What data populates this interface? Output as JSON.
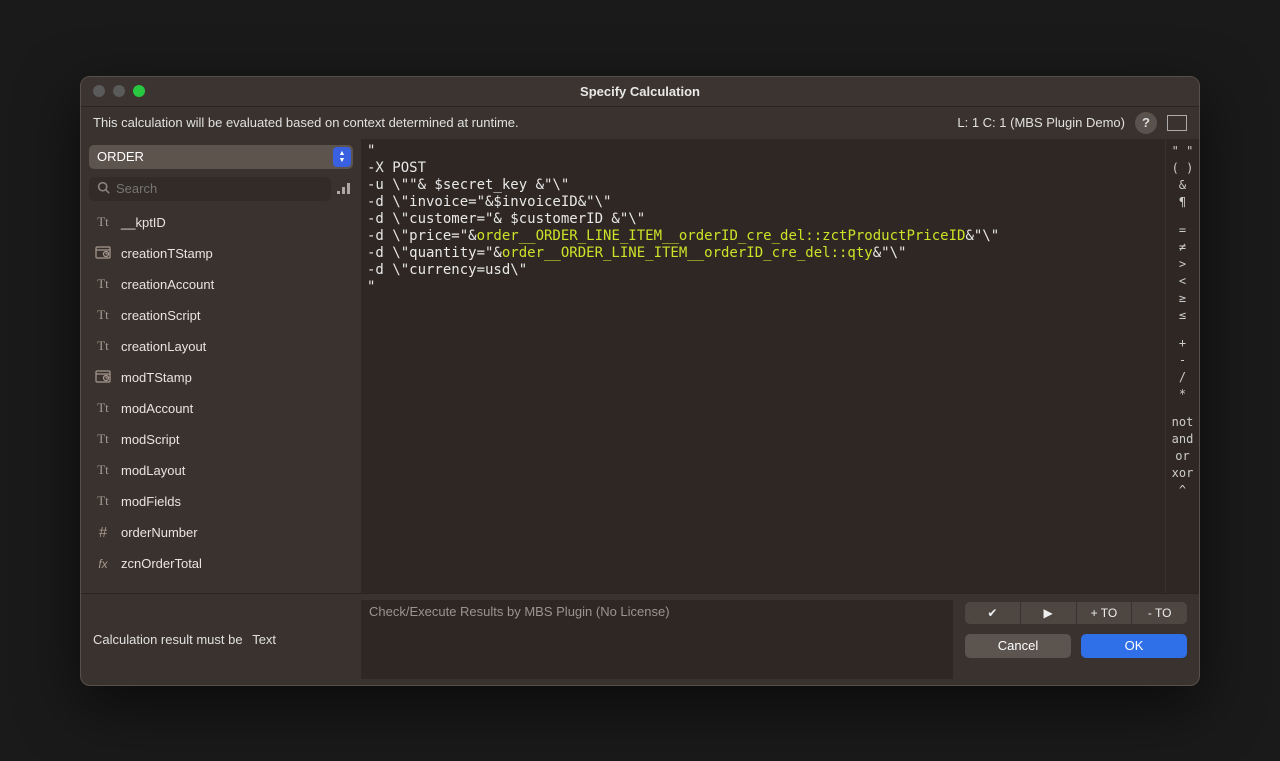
{
  "window": {
    "title": "Specify Calculation"
  },
  "infobar": {
    "context_text": "This calculation will be evaluated based on context determined at runtime.",
    "cursor_info": "L: 1 C: 1 (MBS Plugin Demo)"
  },
  "sidebar": {
    "table_name": "ORDER",
    "search_placeholder": "Search",
    "fields": [
      {
        "icon": "Tt",
        "label": "__kptID"
      },
      {
        "icon": "ts",
        "label": "creationTStamp"
      },
      {
        "icon": "Tt",
        "label": "creationAccount"
      },
      {
        "icon": "Tt",
        "label": "creationScript"
      },
      {
        "icon": "Tt",
        "label": "creationLayout"
      },
      {
        "icon": "ts",
        "label": "modTStamp"
      },
      {
        "icon": "Tt",
        "label": "modAccount"
      },
      {
        "icon": "Tt",
        "label": "modScript"
      },
      {
        "icon": "Tt",
        "label": "modLayout"
      },
      {
        "icon": "Tt",
        "label": "modFields"
      },
      {
        "icon": "#",
        "label": "orderNumber"
      },
      {
        "icon": "fx",
        "label": "zcnOrderTotal"
      }
    ]
  },
  "editor": {
    "lines": [
      {
        "t": "\""
      },
      {
        "t": "-X POST"
      },
      {
        "t": "-u \\\"\"& $secret_key &\"\\\""
      },
      {
        "t": "-d \\\"invoice=\"&$invoiceID&\"\\\""
      },
      {
        "t": "-d \\\"customer=\"& $customerID &\"\\\""
      },
      {
        "pre": "-d \\\"price=\"&",
        "hl": "order__ORDER_LINE_ITEM__orderID_cre_del::zctProductPriceID",
        "post": "&\"\\\""
      },
      {
        "pre": "-d \\\"quantity=\"&",
        "hl": "order__ORDER_LINE_ITEM__orderID_cre_del::qty",
        "post": "&\"\\\""
      },
      {
        "t": "-d \\\"currency=usd\\\""
      },
      {
        "t": "\""
      }
    ]
  },
  "operators": [
    "\" \"",
    "( )",
    "&",
    "¶",
    "",
    "=",
    "≠",
    ">",
    "<",
    "≥",
    "≤",
    "",
    "+",
    "-",
    "/",
    "*",
    "",
    "not",
    "and",
    "or",
    "xor",
    "^"
  ],
  "footer": {
    "result_label": "Calculation result must be",
    "result_type": "Text",
    "results_placeholder": "Check/Execute Results by MBS Plugin (No License)",
    "seg_buttons": [
      "✔",
      "▶",
      "+ TO",
      "- TO"
    ],
    "cancel": "Cancel",
    "ok": "OK"
  }
}
